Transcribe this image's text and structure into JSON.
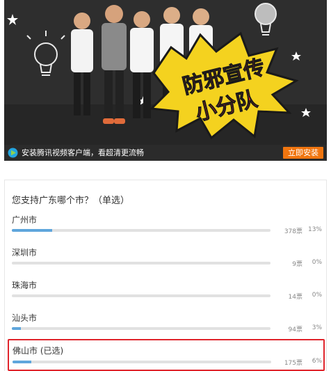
{
  "video": {
    "banner_line1": "防邪宣传",
    "banner_line2": "小分队"
  },
  "player_bar": {
    "promo_text": "安装腾讯视频客户端，看超清更流畅",
    "install_button": "立即安装"
  },
  "poll": {
    "question": "您支持广东哪个市？（单选）",
    "options": [
      {
        "label": "广州市",
        "votes": "378票",
        "percent": "13%",
        "fraction": 0.13,
        "selected": false
      },
      {
        "label": "深圳市",
        "votes": "9票",
        "percent": "0%",
        "fraction": 0.0,
        "selected": false
      },
      {
        "label": "珠海市",
        "votes": "14票",
        "percent": "0%",
        "fraction": 0.0,
        "selected": false
      },
      {
        "label": "汕头市",
        "votes": "94票",
        "percent": "3%",
        "fraction": 0.03,
        "selected": false
      },
      {
        "label": "佛山市 (已选)",
        "votes": "175票",
        "percent": "6%",
        "fraction": 0.06,
        "selected": true
      }
    ]
  },
  "colors": {
    "accent_bar": "#5fa6dc",
    "install_orange": "#f0750f",
    "selected_border": "#e0242b",
    "banner_yellow": "#f4d21f"
  }
}
